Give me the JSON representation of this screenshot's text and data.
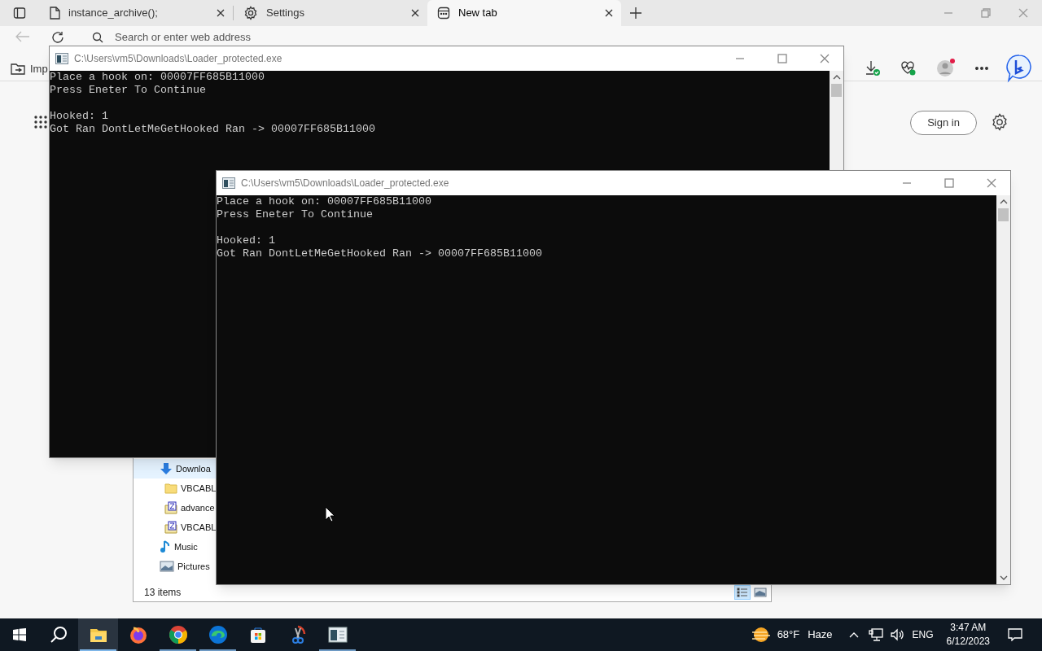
{
  "browser": {
    "tabs": [
      {
        "title": "instance_archive();",
        "kind": "page",
        "selected": false
      },
      {
        "title": "Settings",
        "kind": "settings",
        "selected": false
      },
      {
        "title": "New tab",
        "kind": "newtab",
        "selected": true
      }
    ],
    "address_placeholder": "Search or enter web address",
    "favorites": [
      "Imp"
    ],
    "sign_in": "Sign in"
  },
  "consoles": [
    {
      "title": "C:\\Users\\vm5\\Downloads\\Loader_protected.exe",
      "blocks": [
        [
          "Place a hook on: 00007FF685B11000",
          "Press Eneter To Continue"
        ],
        [
          "Hooked: 1",
          "Got Ran DontLetMeGetHooked Ran -> 00007FF685B11000"
        ]
      ]
    },
    {
      "title": "C:\\Users\\vm5\\Downloads\\Loader_protected.exe",
      "blocks": [
        [
          "Place a hook on: 00007FF685B11000",
          "Press Eneter To Continue"
        ],
        [
          "Hooked: 1",
          "Got Ran DontLetMeGetHooked Ran -> 00007FF685B11000"
        ]
      ]
    }
  ],
  "explorer": {
    "nav_items": [
      {
        "label": "Downloa",
        "kind": "downloads",
        "selected": true,
        "children": [
          {
            "label": "VBCABL",
            "kind": "folder",
            "selected": false
          },
          {
            "label": "advance",
            "kind": "zip",
            "selected": false
          },
          {
            "label": "VBCABL",
            "kind": "zip",
            "selected": false
          }
        ]
      },
      {
        "label": "Music",
        "kind": "music",
        "selected": false
      },
      {
        "label": "Pictures",
        "kind": "pictures",
        "selected": false
      }
    ],
    "status": "13 items"
  },
  "taskbar": {
    "apps": [
      {
        "kind": "explorer",
        "running": true,
        "selected": true
      },
      {
        "kind": "firefox",
        "running": false,
        "selected": false
      },
      {
        "kind": "chrome",
        "running": true,
        "selected": false
      },
      {
        "kind": "edge",
        "running": true,
        "selected": false
      },
      {
        "kind": "store",
        "running": false,
        "selected": false
      },
      {
        "kind": "snip",
        "running": false,
        "selected": false
      },
      {
        "kind": "console",
        "running": true,
        "selected": false
      }
    ],
    "weather": {
      "temperature": "68°F",
      "condition": "Haze"
    },
    "language": "ENG",
    "time": "3:47 AM",
    "date": "6/12/2023"
  }
}
